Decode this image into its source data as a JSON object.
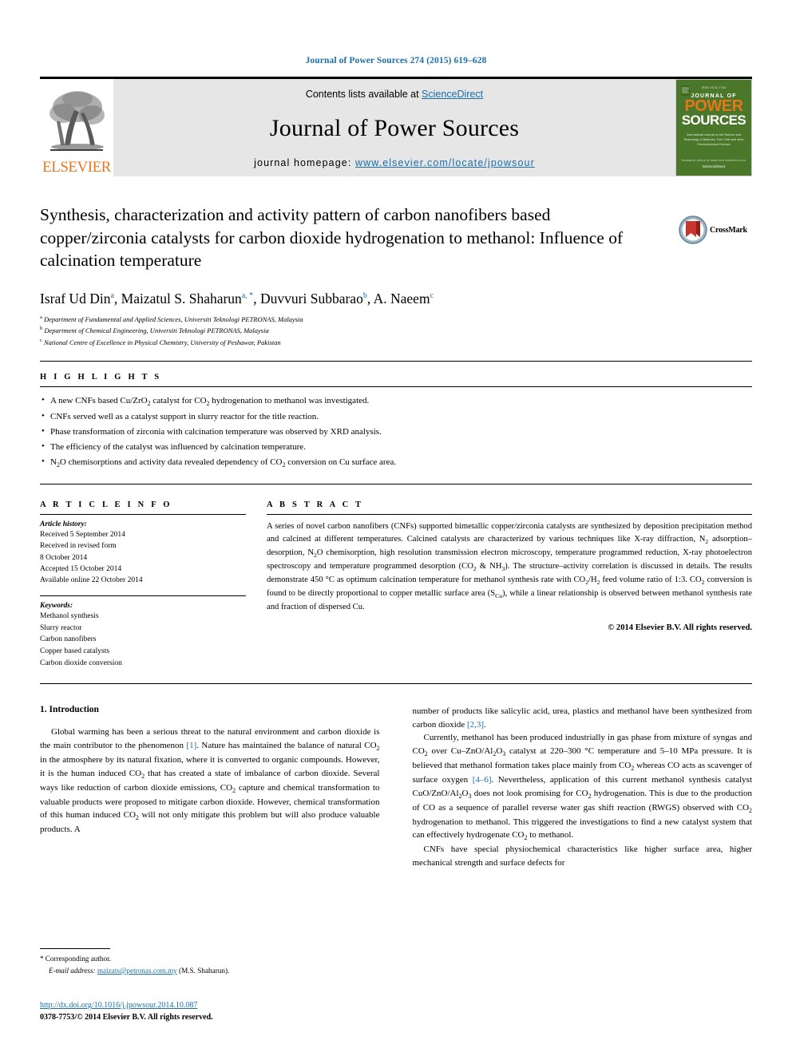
{
  "running_head": "Journal of Power Sources 274 (2015) 619–628",
  "masthead": {
    "elsevier_wordmark": "ELSEVIER",
    "contents_prefix": "Contents lists available at ",
    "sciencedirect_link": "ScienceDirect",
    "journal_title": "Journal of Power Sources",
    "homepage_prefix": "journal homepage: ",
    "homepage_url": "www.elsevier.com/locate/jpowsour",
    "cover": {
      "top_tiny": "ISSN 0378-7753",
      "journal_of": "JOURNAL OF",
      "power": "POWER",
      "sources": "SOURCES",
      "subtitle": "International Journal on the Science and Technology of Batteries, Fuel Cells and other Electrochemical Devices",
      "foot_small": "Available online at www.sciencedirect.com",
      "foot_brand": "ScienceDirect"
    },
    "accent_green": "#4a7729",
    "accent_orange": "#E8761A",
    "link_blue": "#1b6fa8"
  },
  "article": {
    "title": "Synthesis, characterization and activity pattern of carbon nanofibers based copper/zirconia catalysts for carbon dioxide hydrogenation to methanol: Influence of calcination temperature",
    "crossmark_label": "CrossMark",
    "authors": [
      {
        "name": "Israf Ud Din",
        "marks": "a"
      },
      {
        "name": "Maizatul S. Shaharun",
        "marks": "a, *"
      },
      {
        "name": "Duvvuri Subbarao",
        "marks": "b"
      },
      {
        "name": "A. Naeem",
        "marks": "c"
      }
    ],
    "affiliations": [
      {
        "mark": "a",
        "text": "Department of Fundamental and Applied Sciences, Universiti Teknologi PETRONAS, Malaysia"
      },
      {
        "mark": "b",
        "text": "Department of Chemical Engineering, Universiti Teknologi PETRONAS, Malaysia"
      },
      {
        "mark": "c",
        "text": "National Centre of Excellence in Physical Chemistry, University of Peshawar, Pakistan"
      }
    ]
  },
  "highlights": {
    "heading": "H I G H L I G H T S",
    "items": [
      "A new CNFs based Cu/ZrO2 catalyst for CO2 hydrogenation to methanol was investigated.",
      "CNFs served well as a catalyst support in slurry reactor for the title reaction.",
      "Phase transformation of zirconia with calcination temperature was observed by XRD analysis.",
      "The efficiency of the catalyst was influenced by calcination temperature.",
      "N2O chemisorptions and activity data revealed dependency of CO2 conversion on Cu surface area."
    ]
  },
  "article_info": {
    "heading": "A R T I C L E   I N F O",
    "history_label": "Article history:",
    "history": [
      "Received 5 September 2014",
      "Received in revised form",
      "8 October 2014",
      "Accepted 15 October 2014",
      "Available online 22 October 2014"
    ],
    "keywords_label": "Keywords:",
    "keywords": [
      "Methanol synthesis",
      "Slurry reactor",
      "Carbon nanofibers",
      "Copper based catalysts",
      "Carbon dioxide conversion"
    ]
  },
  "abstract": {
    "heading": "A B S T R A C T",
    "text": "A series of novel carbon nanofibers (CNFs) supported bimetallic copper/zirconia catalysts are synthesized by deposition precipitation method and calcined at different temperatures. Calcined catalysts are characterized by various techniques like X-ray diffraction, N2 adsorption–desorption, N2O chemisorption, high resolution transmission electron microscopy, temperature programmed reduction, X-ray photoelectron spectroscopy and temperature programmed desorption (CO2 & NH3). The structure–activity correlation is discussed in details. The results demonstrate 450 °C as optimum calcination temperature for methanol synthesis rate with CO2/H2 feed volume ratio of 1:3. CO2 conversion is found to be directly proportional to copper metallic surface area (SCu), while a linear relationship is observed between methanol synthesis rate and fraction of dispersed Cu.",
    "copyright": "© 2014 Elsevier B.V. All rights reserved."
  },
  "introduction": {
    "section_number": "1.",
    "section_title": "Introduction",
    "left_paragraph": "Global warming has been a serious threat to the natural environment and carbon dioxide is the main contributor to the phenomenon [1]. Nature has maintained the balance of natural CO2 in the atmosphere by its natural fixation, where it is converted to organic compounds. However, it is the human induced CO2 that has created a state of imbalance of carbon dioxide. Several ways like reduction of carbon dioxide emissions, CO2 capture and chemical transformation to valuable products were proposed to mitigate carbon dioxide. However, chemical transformation of this human induced CO2 will not only mitigate this problem but will also produce valuable products. A",
    "right_paragraph_1": "number of products like salicylic acid, urea, plastics and methanol have been synthesized from carbon dioxide [2,3].",
    "right_paragraph_2": "Currently, methanol has been produced industrially in gas phase from mixture of syngas and CO2 over Cu–ZnO/Al2O3 catalyst at 220–300 °C temperature and 5–10 MPa pressure. It is believed that methanol formation takes place mainly from CO2 whereas CO acts as scavenger of surface oxygen [4–6]. Nevertheless, application of this current methanol synthesis catalyst CuO/ZnO/Al2O3 does not look promising for CO2 hydrogenation. This is due to the production of CO as a sequence of parallel reverse water gas shift reaction (RWGS) observed with CO2 hydrogenation to methanol. This triggered the investigations to find a new catalyst system that can effectively hydrogenate CO2 to methanol.",
    "right_paragraph_3": "CNFs have special physiochemical characteristics like higher surface area, higher mechanical strength and surface defects for"
  },
  "footer": {
    "corresponding_marker": "*",
    "corresponding_label": "Corresponding author.",
    "email_label": "E-mail address:",
    "email": "maizats@petronas.com.my",
    "email_owner": "(M.S. Shaharun).",
    "doi": "http://dx.doi.org/10.1016/j.jpowsour.2014.10.087",
    "issn_line": "0378-7753/© 2014 Elsevier B.V. All rights reserved."
  }
}
